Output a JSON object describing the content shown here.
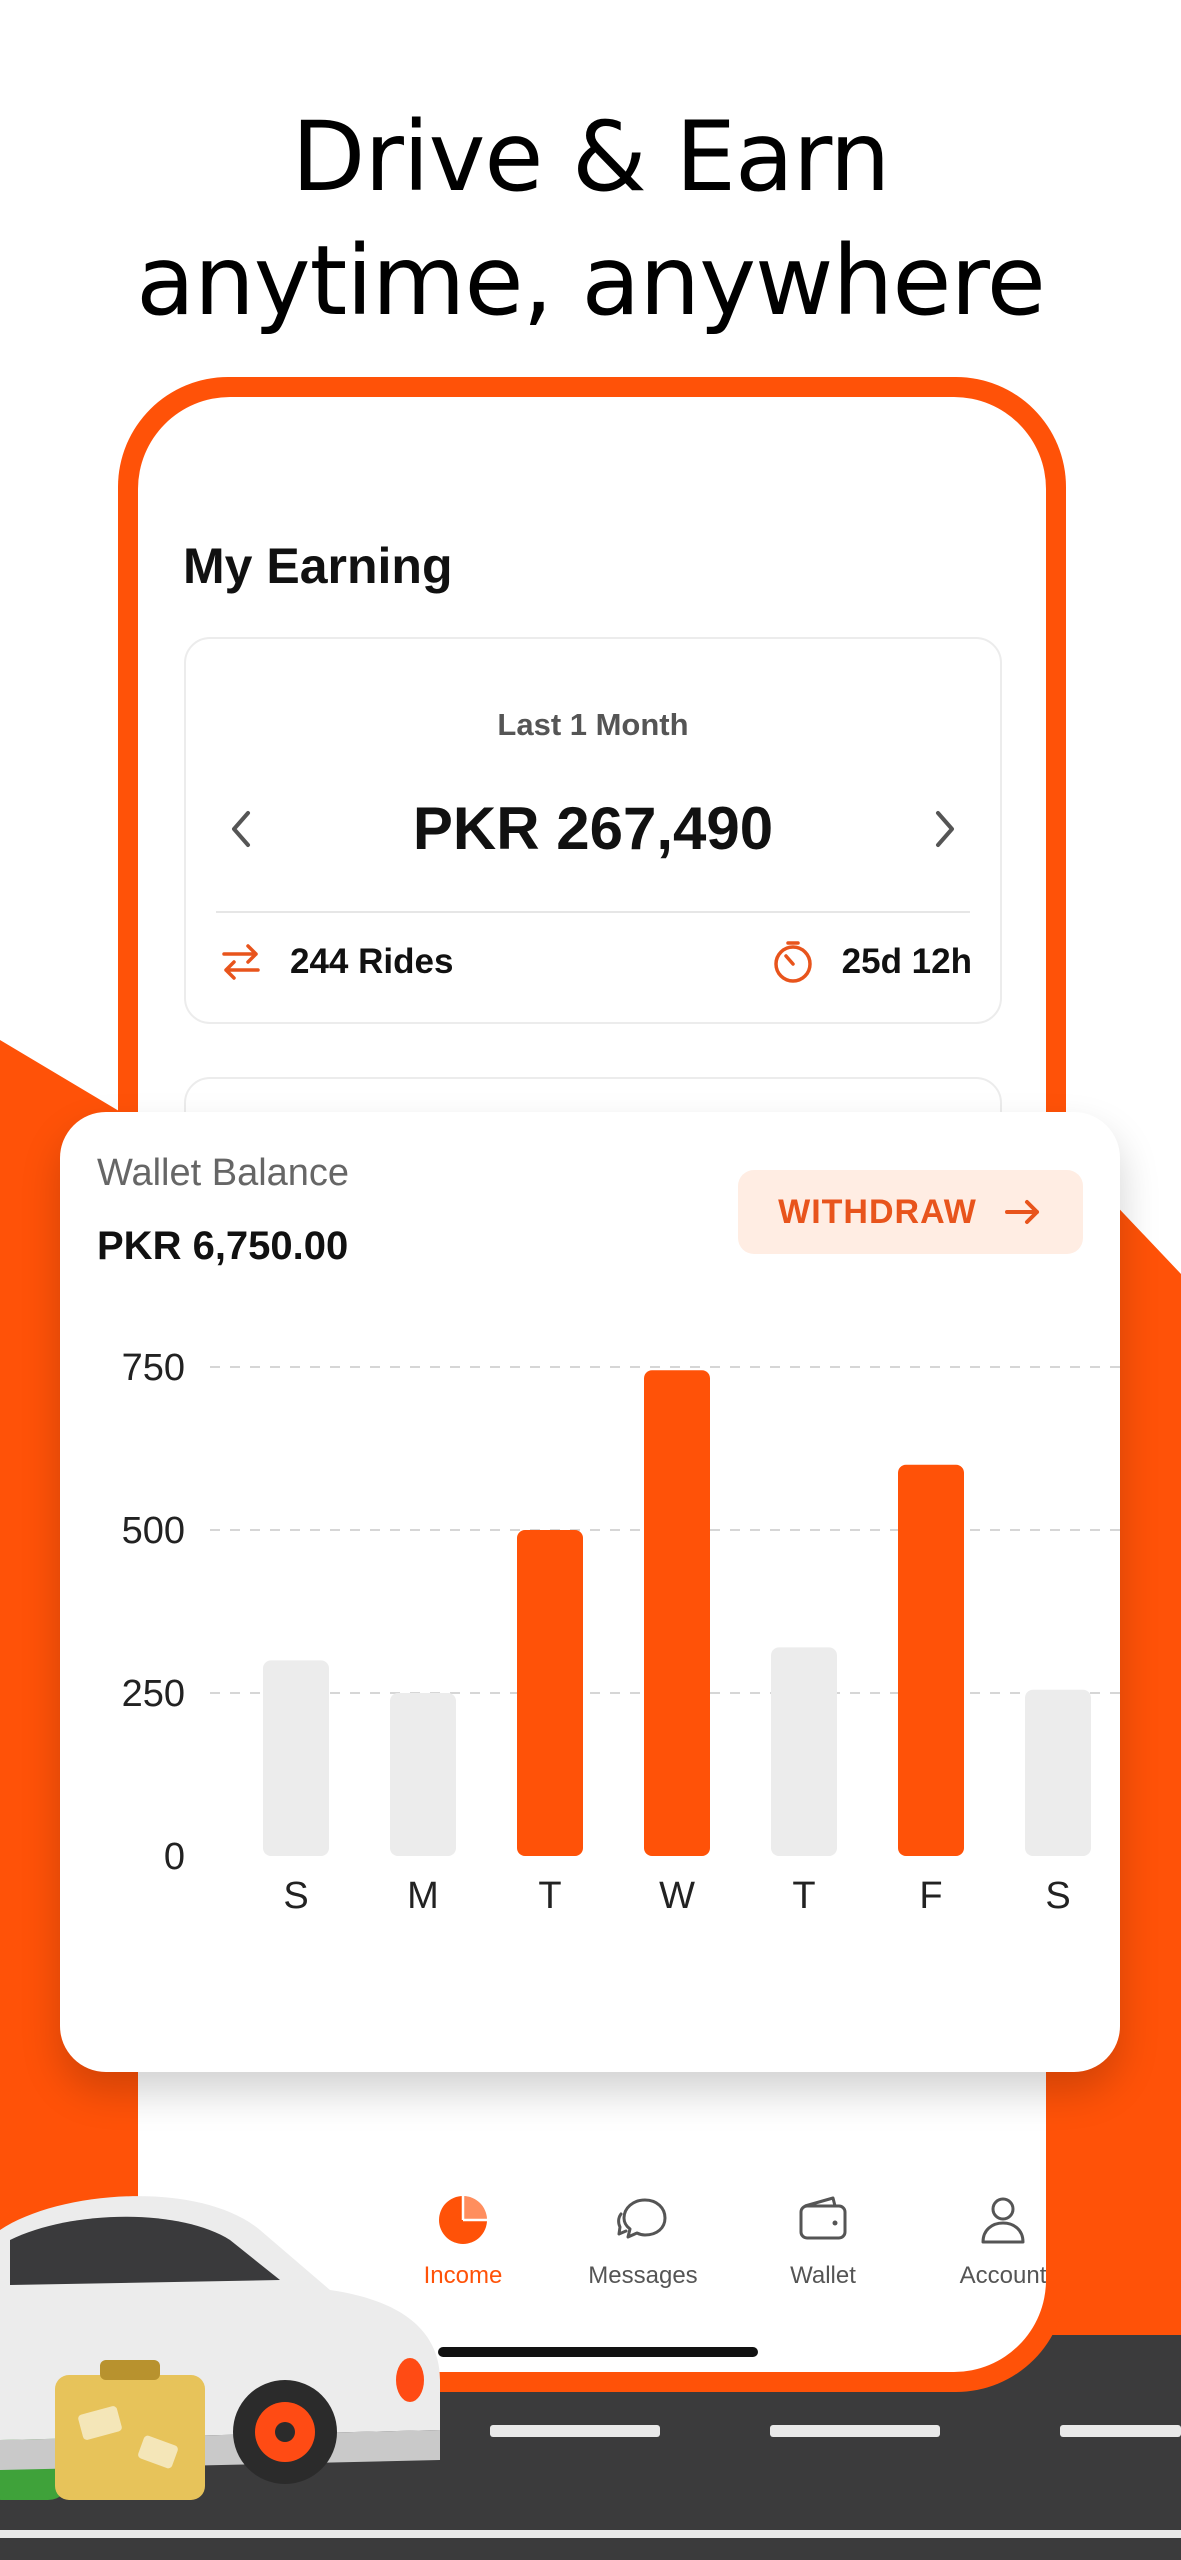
{
  "hero": {
    "line1": "Drive & Earn",
    "line2": "anytime, anywhere"
  },
  "colors": {
    "accent": "#FF5208",
    "bar_inactive": "#ECECEC",
    "withdraw_bg": "#FFEDE3"
  },
  "earning": {
    "title": "My Earning",
    "period": "Last 1 Month",
    "amount": "PKR 267,490",
    "rides": "244 Rides",
    "duration": "25d 12h",
    "prev_icon": "chevron-left-icon",
    "next_icon": "chevron-right-icon"
  },
  "wallet": {
    "label": "Wallet Balance",
    "balance": "PKR 6,750.00",
    "withdraw_label": "WITHDRAW"
  },
  "nav": {
    "items": [
      {
        "label": "Income",
        "icon": "pie-chart-icon",
        "active": true
      },
      {
        "label": "Messages",
        "icon": "chat-icon",
        "active": false
      },
      {
        "label": "Wallet",
        "icon": "wallet-icon",
        "active": false
      },
      {
        "label": "Account",
        "icon": "user-icon",
        "active": false
      }
    ]
  },
  "chart_data": {
    "type": "bar",
    "categories": [
      "S",
      "M",
      "T",
      "W",
      "T",
      "F",
      "S"
    ],
    "values": [
      300,
      250,
      500,
      745,
      320,
      600,
      255
    ],
    "highlighted": [
      false,
      false,
      true,
      true,
      false,
      true,
      false
    ],
    "yticks": [
      0,
      250,
      500,
      750
    ],
    "ylim": [
      0,
      750
    ],
    "grid": true,
    "xlabel": "",
    "ylabel": ""
  }
}
